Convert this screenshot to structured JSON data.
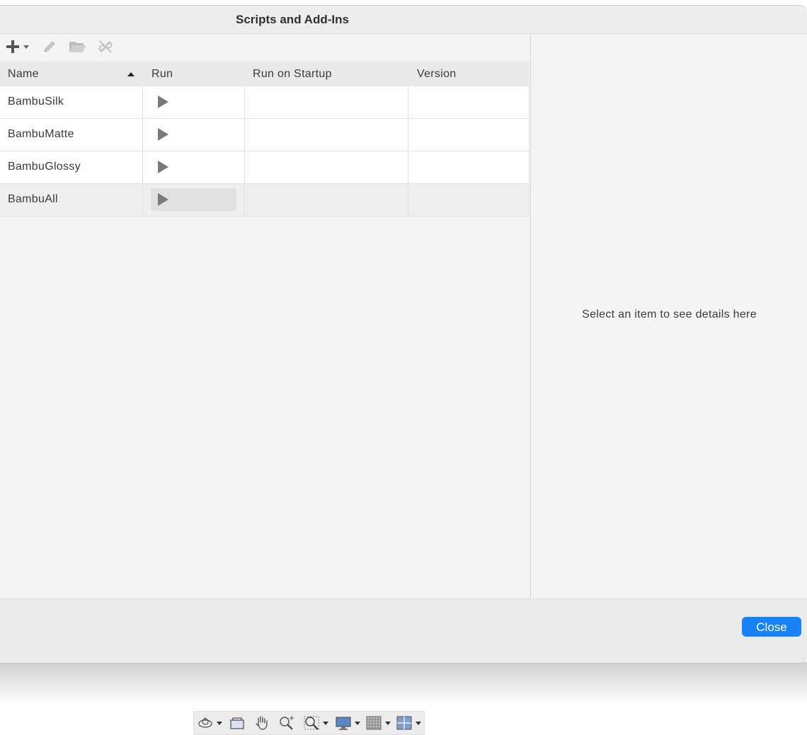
{
  "dialog": {
    "title": "Scripts and Add-Ins",
    "close_label": "Close"
  },
  "toolbar": {
    "icons": [
      "plus-icon",
      "pencil-icon",
      "folder-icon",
      "unlink-icon"
    ]
  },
  "table": {
    "columns": [
      "Name",
      "Run",
      "Run on Startup",
      "Version"
    ],
    "sort_column": "Name",
    "sort_direction": "ascending",
    "rows": [
      {
        "name": "BambuSilk",
        "run_on_startup": "",
        "version": ""
      },
      {
        "name": "BambuMatte",
        "run_on_startup": "",
        "version": ""
      },
      {
        "name": "BambuGlossy",
        "run_on_startup": "",
        "version": ""
      },
      {
        "name": "BambuAll",
        "run_on_startup": "",
        "version": ""
      }
    ],
    "selected_row": "BambuAll"
  },
  "details": {
    "placeholder": "Select an item to see details here"
  },
  "colors": {
    "accent": "#1a82f7",
    "panel": "#f4f4f4",
    "header": "#e9e9e9"
  },
  "bottom_toolbar": {
    "icons": [
      "orbit-icon",
      "look-at-icon",
      "pan-hand-icon",
      "zoom-icon",
      "fit-zoom-icon",
      "display-settings-icon",
      "grid-icon",
      "viewports-icon"
    ]
  }
}
